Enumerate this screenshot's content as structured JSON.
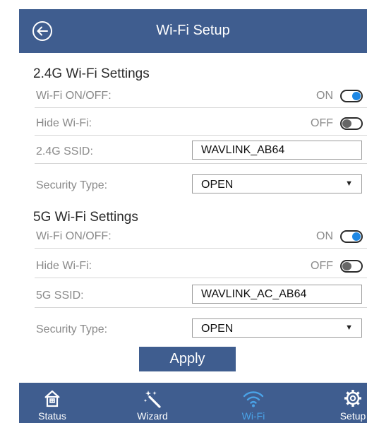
{
  "header": {
    "title": "Wi-Fi Setup",
    "back_icon": "back-arrow-icon"
  },
  "wifi_24": {
    "section_title": "2.4G Wi-Fi Settings",
    "wifi_onoff_label": "Wi-Fi ON/OFF:",
    "wifi_onoff_state": "ON",
    "hide_wifi_label": "Hide Wi-Fi:",
    "hide_wifi_state": "OFF",
    "ssid_label": "2.4G SSID:",
    "ssid_value": "WAVLINK_AB64",
    "security_label": "Security Type:",
    "security_value": "OPEN"
  },
  "wifi_5": {
    "section_title": "5G Wi-Fi Settings",
    "wifi_onoff_label": "Wi-Fi ON/OFF:",
    "wifi_onoff_state": "ON",
    "hide_wifi_label": "Hide Wi-Fi:",
    "hide_wifi_state": "OFF",
    "ssid_label": "5G SSID:",
    "ssid_value": "WAVLINK_AC_AB64",
    "security_label": "Security Type:",
    "security_value": "OPEN"
  },
  "apply_label": "Apply",
  "nav": {
    "items": [
      {
        "label": "Status",
        "icon": "home-icon"
      },
      {
        "label": "Wizard",
        "icon": "magic-wand-icon"
      },
      {
        "label": "Wi-Fi",
        "icon": "wifi-icon",
        "active": true
      },
      {
        "label": "Setup",
        "icon": "gear-icon"
      }
    ]
  },
  "colors": {
    "primary": "#3f5d8f",
    "toggle_on": "#1e88e5",
    "active_nav": "#4aa3e8"
  }
}
